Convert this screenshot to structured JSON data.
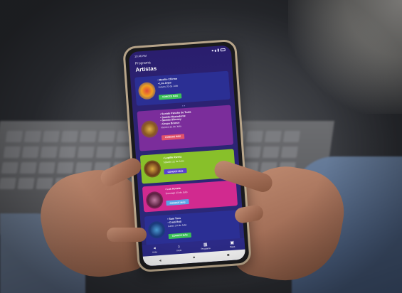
{
  "status_bar": {
    "time": "10:46 AM"
  },
  "header": {
    "crumb": "Programa",
    "title": "Artistas"
  },
  "cards": [
    {
      "artists": [
        "Basilio Chirmo",
        "Los Jojos"
      ],
      "date": "Jueves 20 de Julio",
      "button": "CONOCE MÁS",
      "accent": "#2b2f94",
      "button_color": "#3bbf59"
    },
    {
      "artists": [
        "Sonido Pancho de Tuxla",
        "Sonido Mastodonte",
        "Sonido Siboney",
        "Grupo Bronco"
      ],
      "date": "Viernes 21 de Julio",
      "button": "CONOCE MÁS",
      "accent": "#7b2d9b",
      "button_color": "#e0526b"
    },
    {
      "artists": [
        "Lupillo Rivera"
      ],
      "date": "Sábado 22 de Julio",
      "button": "CONOCE MÁS",
      "accent": "#88c02a",
      "button_color": "#5a3fd0"
    },
    {
      "artists": [
        "Los Acosta"
      ],
      "date": "Domingo 23 de Julio",
      "button": "CONOCE MÁS",
      "accent": "#d12a8f",
      "button_color": "#5aa6e8"
    },
    {
      "artists": [
        "Sam Tuss",
        "Cristi Roll"
      ],
      "date": "Lunes 24 de Julio",
      "button": "CONOCE MÁS",
      "accent": "#2b2f94",
      "button_color": "#3bbf59"
    }
  ],
  "tabbar": [
    {
      "icon": "back-icon",
      "label": "Atrás"
    },
    {
      "icon": "home-icon",
      "label": "Inicio"
    },
    {
      "icon": "program-icon",
      "label": "Programa"
    },
    {
      "icon": "map-icon",
      "label": "Mapa"
    }
  ],
  "pager_dots": "• •",
  "navbar": {
    "back": "◂",
    "home": "●",
    "recent": "■"
  }
}
